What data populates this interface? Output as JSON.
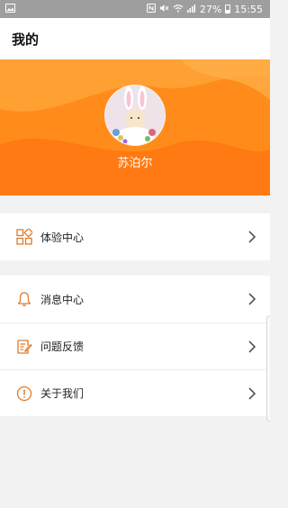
{
  "status_bar": {
    "battery": "27%",
    "time": "15:55",
    "icons": [
      "gallery-icon",
      "nfc-icon",
      "mute-icon",
      "wifi-icon",
      "signal-icon",
      "battery-icon"
    ]
  },
  "header": {
    "title": "我的"
  },
  "profile": {
    "username": "苏泊尔"
  },
  "menu_groups": [
    {
      "items": [
        {
          "label": "体验中心",
          "icon": "apps-grid-icon"
        }
      ]
    },
    {
      "items": [
        {
          "label": "消息中心",
          "icon": "bell-icon"
        },
        {
          "label": "问题反馈",
          "icon": "feedback-icon"
        },
        {
          "label": "关于我们",
          "icon": "info-icon"
        }
      ]
    }
  ],
  "colors": {
    "accent": "#ff8c1a",
    "icon_color": "#e07a2a",
    "background": "#f2f2f2"
  }
}
